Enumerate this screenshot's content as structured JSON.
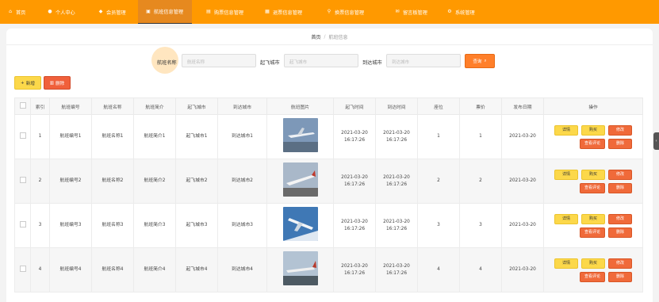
{
  "nav": {
    "items": [
      {
        "label": "首页",
        "icon": "home-icon"
      },
      {
        "label": "个人中心",
        "icon": "user-icon"
      },
      {
        "label": "会员管理",
        "icon": "members-icon"
      },
      {
        "label": "航班信息管理",
        "icon": "flight-icon"
      },
      {
        "label": "购票信息管理",
        "icon": "ticket-icon"
      },
      {
        "label": "退票信息管理",
        "icon": "refund-icon"
      },
      {
        "label": "换票信息管理",
        "icon": "exchange-icon"
      },
      {
        "label": "留言板管理",
        "icon": "message-icon"
      },
      {
        "label": "系统管理",
        "icon": "settings-icon"
      }
    ],
    "active_index": 3,
    "accent": "#ff9900"
  },
  "breadcrumb": {
    "home": "首页",
    "separator": "/",
    "current": "航班信息"
  },
  "search": {
    "field1_label": "航班名称",
    "field1_placeholder": "航班名称",
    "field2_label": "起飞城市",
    "field2_placeholder": "起飞城市",
    "field3_label": "到达城市",
    "field3_placeholder": "到达城市",
    "button": "查询"
  },
  "actions": {
    "add": "新增",
    "delete": "删除"
  },
  "table": {
    "headers": [
      "索引",
      "航班编号",
      "航班名称",
      "航班简介",
      "起飞城市",
      "到达城市",
      "航班图片",
      "起飞时间",
      "到达时间",
      "座位",
      "票价",
      "发布日期",
      "操作"
    ],
    "rows": [
      {
        "index": "1",
        "code": "航班编号1",
        "name": "航班名称1",
        "intro": "航班简介1",
        "from": "起飞城市1",
        "to": "到达城市1",
        "depart": "2021-03-20 16:17:26",
        "arrive": "2021-03-20 16:17:26",
        "seats": "1",
        "price": "1",
        "date": "2021-03-20"
      },
      {
        "index": "2",
        "code": "航班编号2",
        "name": "航班名称2",
        "intro": "航班简介2",
        "from": "起飞城市2",
        "to": "到达城市2",
        "depart": "2021-03-20 16:17:26",
        "arrive": "2021-03-20 16:17:26",
        "seats": "2",
        "price": "2",
        "date": "2021-03-20"
      },
      {
        "index": "3",
        "code": "航班编号3",
        "name": "航班名称3",
        "intro": "航班简介3",
        "from": "起飞城市3",
        "to": "到达城市3",
        "depart": "2021-03-20 16:17:26",
        "arrive": "2021-03-20 16:17:26",
        "seats": "3",
        "price": "3",
        "date": "2021-03-20"
      },
      {
        "index": "4",
        "code": "航班编号4",
        "name": "航班名称4",
        "intro": "航班简介4",
        "from": "起飞城市4",
        "to": "到达城市4",
        "depart": "2021-03-20 16:17:26",
        "arrive": "2021-03-20 16:17:26",
        "seats": "4",
        "price": "4",
        "date": "2021-03-20"
      }
    ],
    "ops": {
      "detail": "详情",
      "buy": "购买",
      "edit": "修改",
      "comment": "查看评论",
      "remove": "删除"
    }
  }
}
